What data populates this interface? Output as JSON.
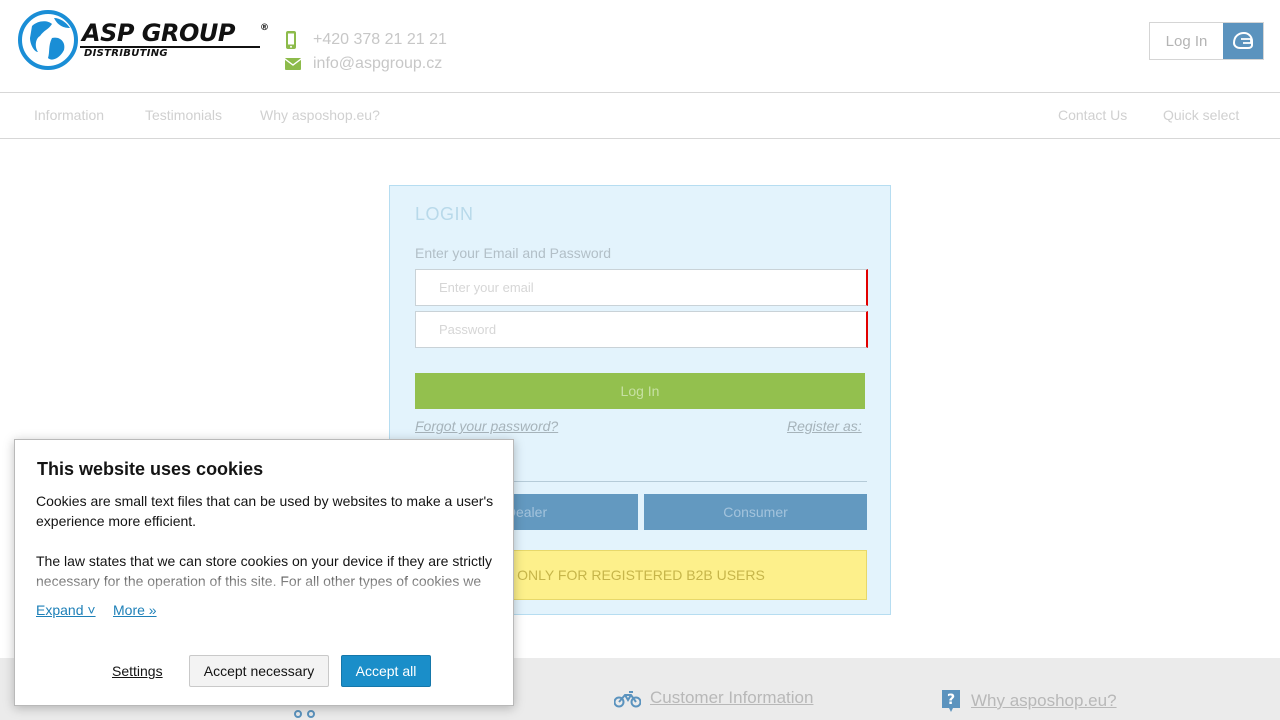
{
  "header": {
    "logo_text": "ASP GROUP",
    "logo_registered": "®",
    "logo_sub": "DISTRIBUTING",
    "phone": "+420 378 21 21 21",
    "email": "info@aspgroup.cz",
    "login_label": "Log In"
  },
  "nav": {
    "left": [
      "Information",
      "Testimonials",
      "Why asposhop.eu?"
    ],
    "right": [
      "Contact Us",
      "Quick select"
    ]
  },
  "login": {
    "title": "LOGIN",
    "subtitle": "Enter your Email and Password",
    "email_placeholder": "Enter your email",
    "password_placeholder": "Password",
    "submit_label": "Log In",
    "forgot_label": "Forgot your password?",
    "register_label": "Register as:",
    "dealer_label": "Dealer",
    "consumer_label": "Consumer",
    "notice": "ONLY FOR REGISTERED B2B USERS"
  },
  "footer": {
    "links": [
      "Customer Information",
      "Why asposhop.eu?"
    ]
  },
  "cookie": {
    "title": "This website uses cookies",
    "para1": "Cookies are small text files that can be used by websites to make a user's experience more efficient.",
    "para2": "The law states that we can store cookies on your device if they are strictly necessary for the operation of this site. For all other types of cookies we",
    "expand_label": "Expand ˅",
    "more_label": "More »",
    "settings_label": "Settings",
    "necessary_label": "Accept necessary",
    "all_label": "Accept all"
  },
  "colors": {
    "accent_green": "#93c04e",
    "accent_blue": "#5b93be",
    "cookie_primary": "#1a8ec9",
    "notice_yellow": "#fdf08b",
    "error_red": "#e20000"
  }
}
